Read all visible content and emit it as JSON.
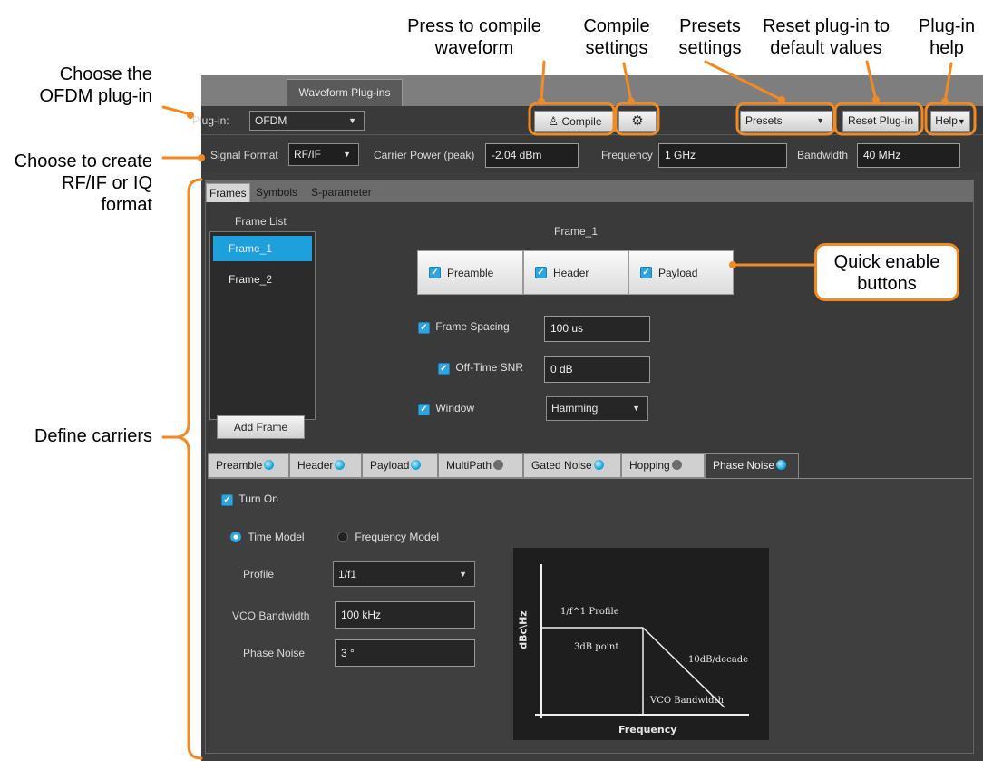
{
  "callouts": {
    "choose_plugin_1": "Choose the",
    "choose_plugin_2": "OFDM plug-in",
    "choose_format_1": "Choose to create",
    "choose_format_2": "RF/IF or IQ",
    "choose_format_3": "format",
    "define_carriers": "Define carriers",
    "compile_wave_1": "Press to compile",
    "compile_wave_2": "waveform",
    "compile_settings_1": "Compile",
    "compile_settings_2": "settings",
    "presets_settings_1": "Presets",
    "presets_settings_2": "settings",
    "reset_defaults_1": "Reset plug-in to",
    "reset_defaults_2": "default values",
    "plugin_help_1": "Plug-in",
    "plugin_help_2": "help",
    "quick_enable_1": "Quick enable",
    "quick_enable_2": "buttons"
  },
  "app": {
    "window_tab": "Waveform Plug-ins",
    "toolbar": {
      "plugin_label": "Plug-in:",
      "plugin_value": "OFDM",
      "compile_label": "Compile",
      "presets_label": "Presets",
      "reset_label": "Reset Plug-in",
      "help_label": "Help"
    },
    "signal": {
      "format_label": "Signal Format",
      "format_value": "RF/IF",
      "carrier_power_label": "Carrier Power (peak)",
      "carrier_power_value": "-2.04 dBm",
      "frequency_label": "Frequency",
      "frequency_value": "1 GHz",
      "bandwidth_label": "Bandwidth",
      "bandwidth_value": "40 MHz"
    },
    "subtabs": [
      "Frames",
      "Symbols",
      "S-parameter"
    ],
    "frames": {
      "list_title": "Frame List",
      "items": [
        "Frame_1",
        "Frame_2"
      ],
      "add_button": "Add Frame",
      "current_frame": "Frame_1",
      "quick": {
        "preamble": "Preamble",
        "header": "Header",
        "payload": "Payload"
      },
      "frame_spacing_label": "Frame Spacing",
      "frame_spacing_value": "100 us",
      "off_time_snr_label": "Off-Time SNR",
      "off_time_snr_value": "0 dB",
      "window_label": "Window",
      "window_value": "Hamming"
    },
    "component_tabs": [
      {
        "label": "Preamble",
        "enabled": true
      },
      {
        "label": "Header",
        "enabled": true
      },
      {
        "label": "Payload",
        "enabled": true
      },
      {
        "label": "MultiPath",
        "enabled": false
      },
      {
        "label": "Gated Noise",
        "enabled": true
      },
      {
        "label": "Hopping",
        "enabled": false
      },
      {
        "label": "Phase Noise",
        "enabled": true
      }
    ],
    "phase_noise": {
      "turn_on_label": "Turn On",
      "time_model_label": "Time Model",
      "freq_model_label": "Frequency Model",
      "profile_label": "Profile",
      "profile_value": "1/f1",
      "vco_bw_label": "VCO Bandwidth",
      "vco_bw_value": "100 kHz",
      "phase_noise_label": "Phase Noise",
      "phase_noise_value": "3 °"
    },
    "graph": {
      "ylabel": "dBc\\Hz",
      "xlabel": "Frequency",
      "profile_text": "1/f^1 Profile",
      "point_text": "3dB point",
      "slope_text": "10dB/decade",
      "vco_text": "VCO Bandwidth"
    }
  },
  "colors": {
    "callout_outline": "#f08a24",
    "selection_blue": "#1ea0dc",
    "panel_bg": "#3d3d3d"
  }
}
